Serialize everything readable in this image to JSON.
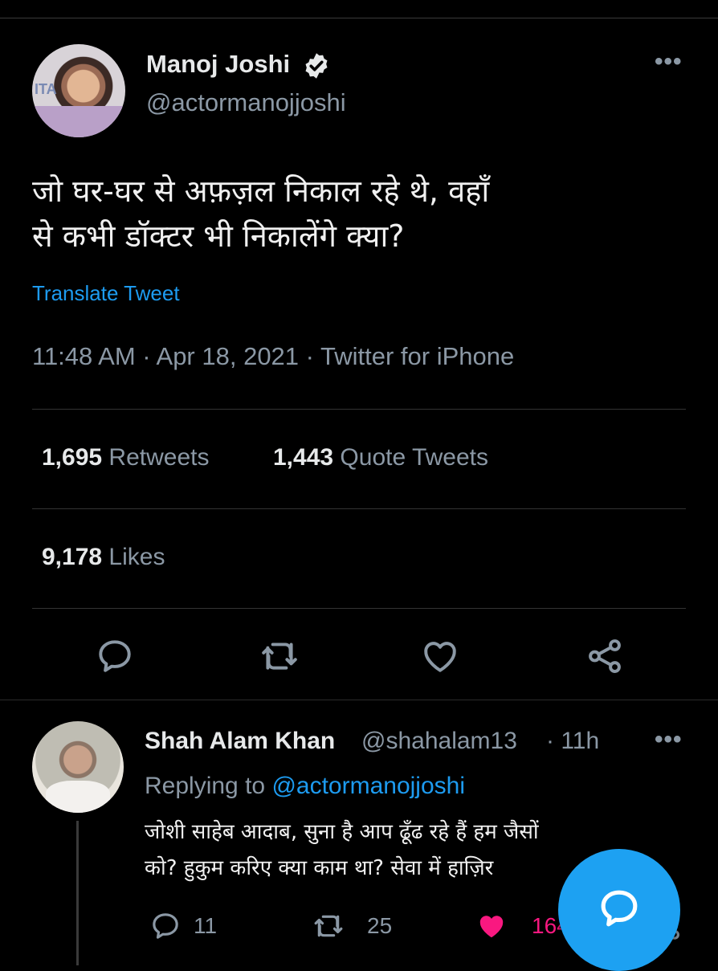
{
  "tweet": {
    "author_name": "Manoj Joshi",
    "author_handle": "@actormanojjoshi",
    "avatar_tag": "ITA",
    "text_line1": "जो घर-घर से अफ़ज़ल निकाल रहे थे, वहाँ",
    "text_line2": "से कभी डॉक्टर भी निकालेंगे क्या?",
    "translate_label": "Translate Tweet",
    "meta": "11:48 AM · Apr 18, 2021 · Twitter for iPhone",
    "retweets_count": "1,695",
    "retweets_label": "Retweets",
    "quotes_count": "1,443",
    "quotes_label": "Quote Tweets",
    "likes_count": "9,178",
    "likes_label": "Likes",
    "more_label": "•••"
  },
  "reply": {
    "author_name": "Shah Alam Khan",
    "author_handle": "@shahalam13",
    "time": "· 11h",
    "replying_to_label": "Replying to",
    "replying_to_handle": "@actormanojjoshi",
    "text_line1": "जोशी साहेब आदाब, सुना है आप ढूँढ रहे हैं हम जैसों",
    "text_line2": "को? हुकुम करिए क्या काम था? सेवा में हाज़िर",
    "reply_count": "11",
    "retweet_count": "25",
    "like_count": "164",
    "more_label": "•••"
  },
  "colors": {
    "accent": "#1d9bf0",
    "like": "#f91880",
    "fab": "#1da1f2",
    "muted": "#8b98a5"
  },
  "icons": [
    "verified-icon",
    "more-icon",
    "reply-icon",
    "retweet-icon",
    "like-icon",
    "share-icon",
    "compose-icon"
  ]
}
